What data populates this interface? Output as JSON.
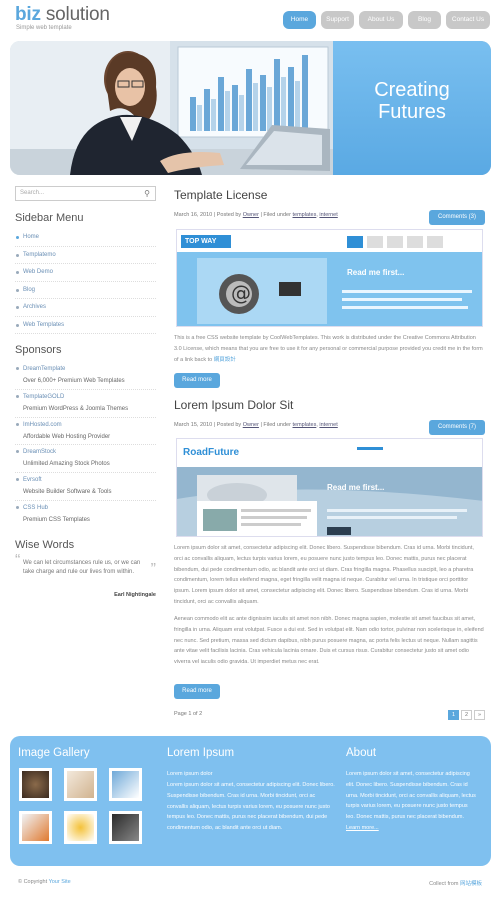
{
  "header": {
    "logo_bold": "biz",
    "logo_rest": " solution",
    "tagline": "Simple web template",
    "nav": [
      "Home",
      "Support",
      "About Us",
      "Blog",
      "Contact Us"
    ]
  },
  "hero": {
    "caption_line1": "Creating",
    "caption_line2": "Futures"
  },
  "sidebar": {
    "search_placeholder": "Search...",
    "menu_title": "Sidebar Menu",
    "menu": [
      "Home",
      "Templatemo",
      "Web Demo",
      "Blog",
      "Archives",
      "Web Templates"
    ],
    "sponsors_title": "Sponsors",
    "sponsors": [
      {
        "name": "DreamTemplate",
        "desc": "Over 6,000+ Premium Web Templates"
      },
      {
        "name": "TemplateGOLD",
        "desc": "Premium WordPress & Joomla Themes"
      },
      {
        "name": "ImHosted.com",
        "desc": "Affordable Web Hosting Provider"
      },
      {
        "name": "DreamStock",
        "desc": "Unlimited Amazing Stock Photos"
      },
      {
        "name": "Evrsoft",
        "desc": "Website Builder Software & Tools"
      },
      {
        "name": "CSS Hub",
        "desc": "Premium CSS Templates"
      }
    ],
    "words_title": "Wise Words",
    "quote": "We can let circumstances rule us, or we can take charge and rule our lives from within.",
    "quote_author": "Earl Nightingale"
  },
  "posts": [
    {
      "title": "Template License",
      "date": "March 16, 2010",
      "posted_by": "Posted by",
      "author": "Owner",
      "filed": "Filed under",
      "cat1": "templates",
      "cat2": "internet",
      "comments": "Comments (3)",
      "text": "This is a free CSS website template by CoolWebTemplates. This work is distributed under the Creative Commons Attribution 3.0 License, which means that you are free to use it for any personal or commercial purpose provided you credit me in the form of a link back to",
      "link": "網頁設計",
      "more": "Read more",
      "img_brand": "TOP WAY",
      "img_headline": "Read me first..."
    },
    {
      "title": "Lorem Ipsum Dolor Sit",
      "date": "March 15, 2010",
      "posted_by": "Posted by",
      "author": "Owner",
      "filed": "Filed under",
      "cat1": "templates",
      "cat2": "internet",
      "comments": "Comments (7)",
      "para1": "Lorem ipsum dolor sit amet, consectetur adipiscing elit. Donec libero. Suspendisse bibendum. Cras id urna. Morbi tincidunt, orci ac convallis aliquam, lectus turpis varius lorem, eu posuere nunc justo tempus leo. Donec mattis, purus nec placerat bibendum, dui pede condimentum odio, ac blandit ante orci ut diam. Cras fringilla magna. Phasellus suscipit, leo a pharetra condimentum, lorem tellus eleifend magna, eget fringilla velit magna id neque. Curabitur vel urna. In tristique orci porttitor ipsum. Lorem ipsum dolor sit amet, consectetur adipiscing elit. Donec libero. Suspendisse bibendum. Cras id urna. Morbi tincidunt, orci ac convallis aliquam.",
      "para2": "Aenean commodo elit ac ante dignissim iaculis sit amet non nibh. Donec magna sapien, molestie sit amet faucibus sit amet, fringilla in urna. Aliquam erat volutpat. Fusce a dui est. Sed in volutpat elit. Nam odio tortor, pulvinar non scelerisque in, eleifend nec nunc. Sed pretium, massa sed dictum dapibus, nibh purus posuere magna, ac porta felis lectus ut neque. Nullam sagittis ante vitae velit facilisis lacinia. Cras vehicula lacinia ornare. Duis et cursus risus. Curabitur consectetur justo sit amet odio viverra vel iaculis odio gravida. Ut imperdiet metus nec erat.",
      "more": "Read more",
      "img_brand": "RoadFuture",
      "img_headline": "Read me first..."
    }
  ],
  "pagination": {
    "label": "Page 1 of 2",
    "pages": [
      "1",
      "2",
      "»"
    ]
  },
  "footer": {
    "gallery_title": "Image Gallery",
    "lorem_title": "Lorem Ipsum",
    "lorem_lead": "Lorem ipsum dolor",
    "lorem_text": "Lorem ipsum dolor sit amet, consectetur adipiscing elit. Donec libero. Suspendisse bibendum. Cras id urna. Morbi tincidunt, orci ac convallis aliquam, lectus turpis varius lorem, eu posuere nunc justo tempus leo. Donec mattis, purus nec placerat bibendum, dui pede condimentum odio, ac blandit ante orci ut diam.",
    "about_title": "About",
    "about_text": "Lorem ipsum dolor sit amet, consectetur adipiscing elit. Donec libero. Suspendisse bibendum. Cras id urna. Morbi tincidunt, orci ac convallis aliquam, lectus turpis varius lorem, eu posuere nunc justo tempus leo. Donec mattis, purus nec placerat bibendum.",
    "learn_more": "Learn more..."
  },
  "bottom": {
    "copyright": "© Copyright",
    "site": "Your Site",
    "credit": "Collect from",
    "credit_link": "网站模板"
  }
}
